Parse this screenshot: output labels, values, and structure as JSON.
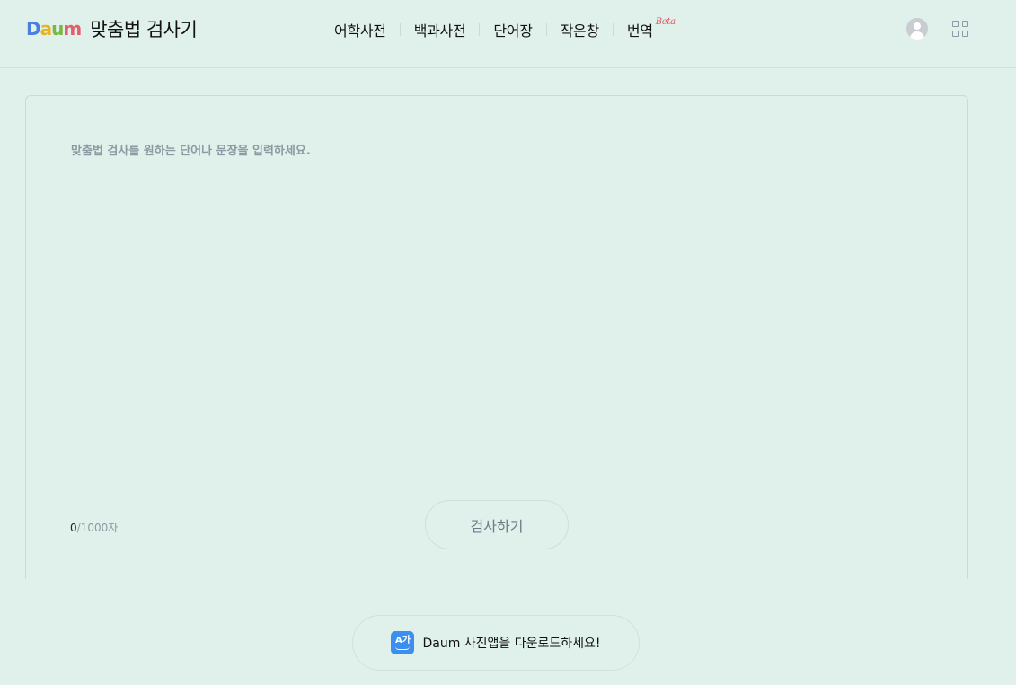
{
  "header": {
    "logo_text": "Daum",
    "service_title": "맞춤법 검사기",
    "nav": [
      {
        "label": "어학사전"
      },
      {
        "label": "백과사전"
      },
      {
        "label": "단어장"
      },
      {
        "label": "작은창"
      },
      {
        "label": "번역",
        "badge": "Beta"
      }
    ],
    "user_icon": "user-avatar-icon",
    "apps_icon": "grid-menu-icon"
  },
  "editor": {
    "placeholder": "맞춤법 검사를 원하는 단어나 문장을 입력하세요.",
    "value": "",
    "count_current": "0",
    "count_max": "/1000자",
    "submit_label": "검사하기"
  },
  "app_banner": {
    "icon_text": "A가",
    "text": "Daum 사진앱을 다운로드하세요!"
  },
  "colors": {
    "background": "#dff1ea",
    "beta": "#e3555f",
    "app_icon": "#3b8ff0"
  }
}
